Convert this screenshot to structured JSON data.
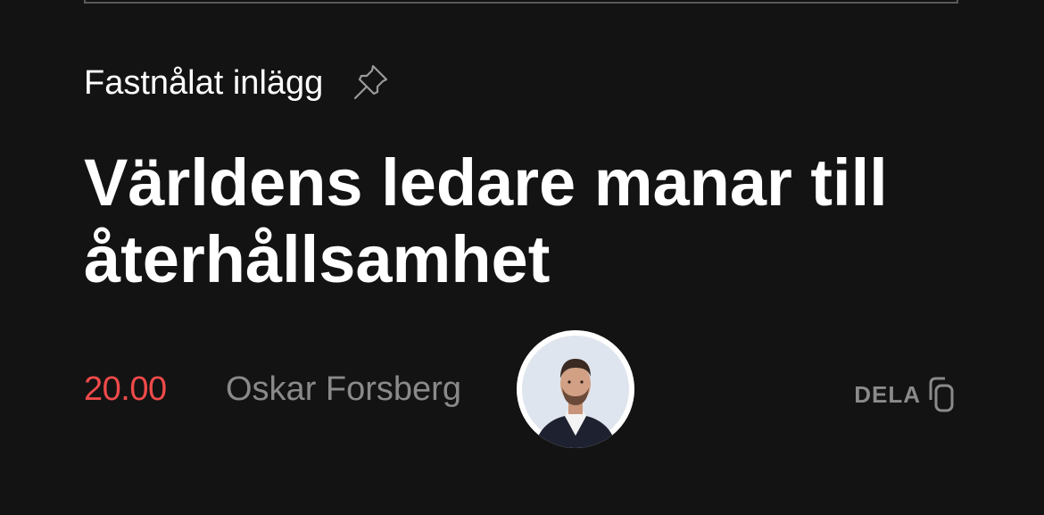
{
  "post": {
    "pinned_label": "Fastnålat inlägg",
    "pinned_icon": "pushpin-icon",
    "headline": "Världens ledare manar till återhållsamhet",
    "time": "20.00",
    "author": "Oskar Forsberg",
    "share_label": "DELA",
    "share_icon": "copy-icon"
  },
  "colors": {
    "background": "#131313",
    "time": "#ef4a4a",
    "muted": "#8a8a8a",
    "text": "#ffffff"
  }
}
